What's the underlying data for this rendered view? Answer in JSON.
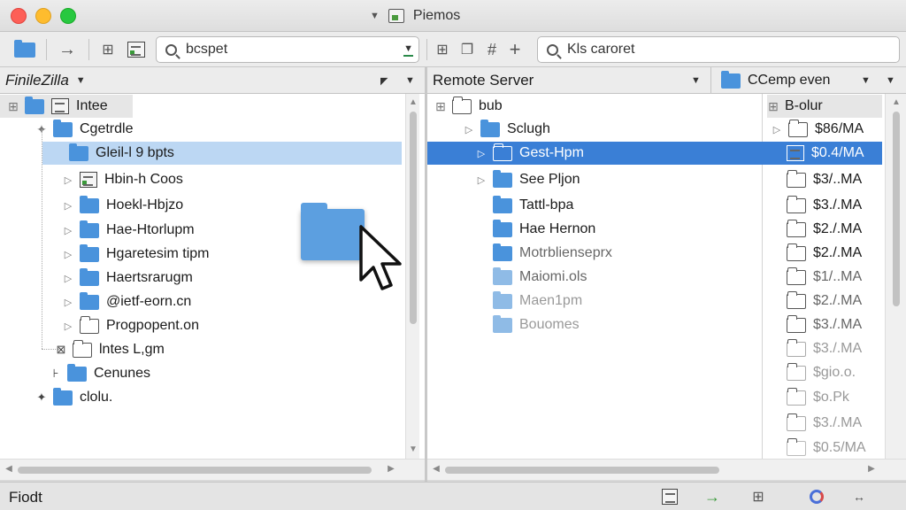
{
  "window": {
    "title": "Piemos"
  },
  "toolbar": {
    "local_search": {
      "value": "bcspet"
    },
    "remote_search": {
      "value": "Kls caroret"
    }
  },
  "local": {
    "header_label": "FinileZilla",
    "tree": [
      {
        "label": "Intee",
        "icon": "doc-icon"
      },
      {
        "label": "Cgetrdle",
        "icon": "folder-icon"
      },
      {
        "label": "Gleil-l 9 bpts",
        "icon": "folder-icon"
      },
      {
        "label": "Hbin-h Coos",
        "icon": "doc-icon"
      },
      {
        "label": "Hoekl-Hbjzo",
        "icon": "folder-icon"
      },
      {
        "label": "Hae-Htorlupm",
        "icon": "folder-icon"
      },
      {
        "label": "Hgaretesim tipm",
        "icon": "folder-icon"
      },
      {
        "label": "Haertsrarugm",
        "icon": "folder-icon"
      },
      {
        "label": "@ietf-eorn.cn",
        "icon": "folder-icon"
      },
      {
        "label": "Progpopent.on",
        "icon": "folder-outline-icon"
      },
      {
        "label": "lntes L,gm",
        "icon": "folder-outline-icon"
      },
      {
        "label": "Cenunes",
        "icon": "folder-icon"
      },
      {
        "label": "clolu.",
        "icon": "folder-icon"
      }
    ]
  },
  "remote": {
    "header_label": "Remote Server",
    "path_dropdown": "CCemp even",
    "col_name": "bub",
    "col_size": "B-olur",
    "rows": [
      {
        "name": "Sclugh",
        "size": "$86/MA"
      },
      {
        "name": "Gest-Hpm",
        "size": "$0.4/MA"
      },
      {
        "name": "See Pljon",
        "size": "$3/..MA"
      },
      {
        "name": "Tattl-bpa",
        "size": "$3./.MA"
      },
      {
        "name": "Hae Hernon",
        "size": "$2./.MA"
      },
      {
        "name": "Motrblienseprx",
        "size": "$2./.MA"
      },
      {
        "name": "Maiomi.ols",
        "size": "$1/..MA"
      },
      {
        "name": "Maen1pm",
        "size": "$2./.MA"
      },
      {
        "name": "Bouomes",
        "size": "$3./.MA"
      },
      {
        "name": "",
        "size": "$3./.MA"
      },
      {
        "name": "",
        "size": "$gio.o."
      },
      {
        "name": "",
        "size": "$o.Pk"
      },
      {
        "name": "",
        "size": "$3./.MA"
      },
      {
        "name": "",
        "size": "$0.5/MA"
      }
    ]
  },
  "status": {
    "text": "Fiodt"
  },
  "colors": {
    "selection": "#bcd7f3",
    "selection_strong": "#3a7fd6",
    "folder": "#4a93dc"
  }
}
